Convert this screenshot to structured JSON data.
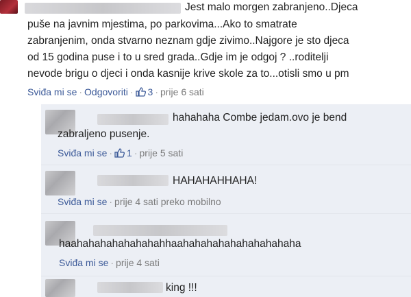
{
  "main_comment": {
    "lines": [
      "Jest malo morgen zabranjeno..Djeca",
      "puše na javnim mjestima, po parkovima...Ako to smatrate",
      "zabranjenim, onda stvarno neznam gdje zivimo..Najgore je sto djeca",
      "od 15 godina puse i to u sred grada..Gdje im je odgoj ? ..roditelji",
      "nevode brigu o djeci i onda kasnije krive skole za to...otisli smo u pm"
    ],
    "like_label": "Sviđa mi se",
    "reply_label": "Odgovoriti",
    "like_count": "3",
    "time": "prije 6 sati"
  },
  "replies": [
    {
      "lines": [
        "hahahaha Combe jedam.ovo je bend",
        "zabraljeno pusenje."
      ],
      "like_label": "Sviđa mi se",
      "like_count": "1",
      "time": "prije 5 sati"
    },
    {
      "lines": [
        "HAHAHAHHAHA!"
      ],
      "like_label": "Sviđa mi se",
      "time": "prije 4 sati preko mobilno"
    },
    {
      "lines": [
        "haahahahahahahahahhaahahahahahahahahahaha"
      ],
      "like_label": "Sviđa mi se",
      "time": "prije 4 sati"
    },
    {
      "lines": [
        "king !!!"
      ]
    }
  ],
  "separator": "·",
  "icons": {
    "like": "thumbs-up-icon"
  },
  "colors": {
    "link": "#3b5998",
    "reply_bg": "#eceff5",
    "meta": "#7a7a7a"
  }
}
